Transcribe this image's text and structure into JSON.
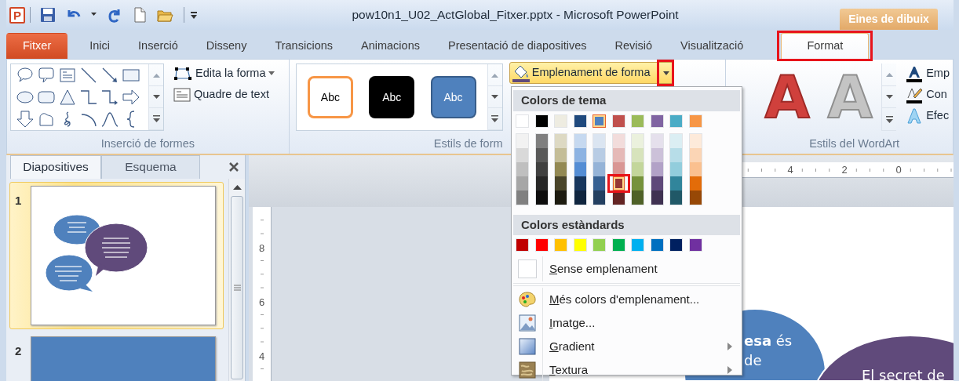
{
  "window": {
    "app_logo": "P",
    "title": "pow10n1_U02_ActGlobal_Fitxer.pptx - Microsoft PowerPoint",
    "context_tab": "Eines de dibuix"
  },
  "tabs": [
    {
      "label": "Fitxer",
      "kind": "file",
      "selected": false,
      "highlighted": false
    },
    {
      "label": "Inici",
      "kind": "normal",
      "selected": false,
      "highlighted": false
    },
    {
      "label": "Inserció",
      "kind": "normal",
      "selected": false,
      "highlighted": false
    },
    {
      "label": "Disseny",
      "kind": "normal",
      "selected": false,
      "highlighted": false
    },
    {
      "label": "Transicions",
      "kind": "normal",
      "selected": false,
      "highlighted": false
    },
    {
      "label": "Animacions",
      "kind": "normal",
      "selected": false,
      "highlighted": false
    },
    {
      "label": "Presentació de diapositives",
      "kind": "normal",
      "selected": false,
      "highlighted": false
    },
    {
      "label": "Revisió",
      "kind": "normal",
      "selected": false,
      "highlighted": false
    },
    {
      "label": "Visualització",
      "kind": "normal",
      "selected": false,
      "highlighted": false
    },
    {
      "label": "Format",
      "kind": "context",
      "selected": true,
      "highlighted": true
    }
  ],
  "ribbon": {
    "shapes_group": {
      "label": "Inserció de formes",
      "commands": [
        {
          "label": "Edita la forma",
          "kind": "edit",
          "dropdown": true
        },
        {
          "label": "Quadre de text",
          "kind": "textbox",
          "dropdown": false
        }
      ]
    },
    "styles_group": {
      "label": "Estils de form",
      "presets": [
        {
          "text": "Abc",
          "kind": "outline"
        },
        {
          "text": "Abc",
          "kind": "dark"
        },
        {
          "text": "Abc",
          "kind": "filled"
        }
      ],
      "fill_button": {
        "label": "Emplenament de forma",
        "open": true,
        "highlighted": true
      }
    },
    "wordart_group": {
      "label": "Estils del WordArt",
      "presets": [
        {
          "text": "A",
          "kind": "red"
        },
        {
          "text": "A",
          "kind": "white"
        }
      ],
      "commands": [
        {
          "label": "Emp",
          "kind": "text_fill"
        },
        {
          "label": "Con",
          "kind": "text_outline"
        },
        {
          "label": "Efec",
          "kind": "text_effects"
        }
      ]
    }
  },
  "slides_pane": {
    "tabs": [
      {
        "label": "Diapositives",
        "selected": true
      },
      {
        "label": "Esquema",
        "selected": false
      }
    ],
    "thumbnails": [
      {
        "number": "1",
        "selected": true,
        "kind": "bubbles"
      },
      {
        "number": "2",
        "selected": false,
        "kind": "blue"
      }
    ]
  },
  "rulers": {
    "horizontal": [
      "4",
      "2",
      "0"
    ],
    "vertical": [
      "8",
      "6",
      "4"
    ]
  },
  "slide": {
    "bubbles": [
      {
        "color": "#4f81bd",
        "lines": [
          "**esa** és",
          "de"
        ]
      },
      {
        "color": "#604a7b",
        "lines": [
          "El secret de"
        ]
      }
    ]
  },
  "fill_menu": {
    "theme_heading": "Colors de tema",
    "theme_colors": [
      {
        "color": "#ffffff",
        "selected": false,
        "shades": [
          {
            "color": "#f2f2f2",
            "selected": false,
            "highlighted": false
          },
          {
            "color": "#d9d9d9",
            "selected": false,
            "highlighted": false
          },
          {
            "color": "#bfbfbf",
            "selected": false,
            "highlighted": false
          },
          {
            "color": "#a6a6a6",
            "selected": false,
            "highlighted": false
          },
          {
            "color": "#808080",
            "selected": false,
            "highlighted": false
          }
        ]
      },
      {
        "color": "#000000",
        "selected": false,
        "shades": [
          {
            "color": "#7f7f7f",
            "selected": false,
            "highlighted": false
          },
          {
            "color": "#595959",
            "selected": false,
            "highlighted": false
          },
          {
            "color": "#404040",
            "selected": false,
            "highlighted": false
          },
          {
            "color": "#262626",
            "selected": false,
            "highlighted": false
          },
          {
            "color": "#0d0d0d",
            "selected": false,
            "highlighted": false
          }
        ]
      },
      {
        "color": "#eeece1",
        "selected": false,
        "shades": [
          {
            "color": "#ddd9c3",
            "selected": false,
            "highlighted": false
          },
          {
            "color": "#c4bd97",
            "selected": false,
            "highlighted": false
          },
          {
            "color": "#938953",
            "selected": false,
            "highlighted": false
          },
          {
            "color": "#494429",
            "selected": false,
            "highlighted": false
          },
          {
            "color": "#1d1b10",
            "selected": false,
            "highlighted": false
          }
        ]
      },
      {
        "color": "#1f497d",
        "selected": false,
        "shades": [
          {
            "color": "#c6d9f0",
            "selected": false,
            "highlighted": false
          },
          {
            "color": "#8db3e2",
            "selected": false,
            "highlighted": false
          },
          {
            "color": "#548dd4",
            "selected": false,
            "highlighted": false
          },
          {
            "color": "#17365d",
            "selected": false,
            "highlighted": false
          },
          {
            "color": "#0f243e",
            "selected": false,
            "highlighted": false
          }
        ]
      },
      {
        "color": "#4f81bd",
        "selected": true,
        "shades": [
          {
            "color": "#dbe5f1",
            "selected": false,
            "highlighted": false
          },
          {
            "color": "#b8cce4",
            "selected": false,
            "highlighted": false
          },
          {
            "color": "#95b3d7",
            "selected": false,
            "highlighted": false
          },
          {
            "color": "#366092",
            "selected": false,
            "highlighted": false
          },
          {
            "color": "#244061",
            "selected": false,
            "highlighted": false
          }
        ]
      },
      {
        "color": "#c0504d",
        "selected": false,
        "shades": [
          {
            "color": "#f2dcdb",
            "selected": false,
            "highlighted": false
          },
          {
            "color": "#e5b9b7",
            "selected": false,
            "highlighted": false
          },
          {
            "color": "#d99694",
            "selected": false,
            "highlighted": false
          },
          {
            "color": "#953734",
            "selected": true,
            "highlighted": true
          },
          {
            "color": "#632423",
            "selected": false,
            "highlighted": false
          }
        ]
      },
      {
        "color": "#9bbb59",
        "selected": false,
        "shades": [
          {
            "color": "#ebf1dd",
            "selected": false,
            "highlighted": false
          },
          {
            "color": "#d7e3bc",
            "selected": false,
            "highlighted": false
          },
          {
            "color": "#c3d69b",
            "selected": false,
            "highlighted": false
          },
          {
            "color": "#76923c",
            "selected": false,
            "highlighted": false
          },
          {
            "color": "#4f6128",
            "selected": false,
            "highlighted": false
          }
        ]
      },
      {
        "color": "#8064a2",
        "selected": false,
        "shades": [
          {
            "color": "#e5e0ec",
            "selected": false,
            "highlighted": false
          },
          {
            "color": "#ccc1d9",
            "selected": false,
            "highlighted": false
          },
          {
            "color": "#b2a2c7",
            "selected": false,
            "highlighted": false
          },
          {
            "color": "#5f497a",
            "selected": false,
            "highlighted": false
          },
          {
            "color": "#3f3151",
            "selected": false,
            "highlighted": false
          }
        ]
      },
      {
        "color": "#4bacc6",
        "selected": false,
        "shades": [
          {
            "color": "#dbeef3",
            "selected": false,
            "highlighted": false
          },
          {
            "color": "#b7dde8",
            "selected": false,
            "highlighted": false
          },
          {
            "color": "#92cddc",
            "selected": false,
            "highlighted": false
          },
          {
            "color": "#31859b",
            "selected": false,
            "highlighted": false
          },
          {
            "color": "#205867",
            "selected": false,
            "highlighted": false
          }
        ]
      },
      {
        "color": "#f79646",
        "selected": false,
        "shades": [
          {
            "color": "#fdeada",
            "selected": false,
            "highlighted": false
          },
          {
            "color": "#fbd5b5",
            "selected": false,
            "highlighted": false
          },
          {
            "color": "#fac08f",
            "selected": false,
            "highlighted": false
          },
          {
            "color": "#e36c09",
            "selected": false,
            "highlighted": false
          },
          {
            "color": "#974806",
            "selected": false,
            "highlighted": false
          }
        ]
      }
    ],
    "standard_heading": "Colors estàndards",
    "standard_colors": [
      {
        "color": "#c00000",
        "selected": false
      },
      {
        "color": "#ff0000",
        "selected": false
      },
      {
        "color": "#ffc000",
        "selected": false
      },
      {
        "color": "#ffff00",
        "selected": false
      },
      {
        "color": "#92d050",
        "selected": false
      },
      {
        "color": "#00b050",
        "selected": false
      },
      {
        "color": "#00b0f0",
        "selected": false
      },
      {
        "color": "#0070c0",
        "selected": false
      },
      {
        "color": "#002060",
        "selected": false
      },
      {
        "color": "#7030a0",
        "selected": false
      }
    ],
    "items": [
      {
        "label": "Sense emplenament",
        "kind": "no_fill",
        "submenu": false,
        "mnemonic": true
      },
      {
        "label": "Més colors d'emplenament...",
        "kind": "palette",
        "submenu": false,
        "mnemonic": true
      },
      {
        "label": "Imatge...",
        "kind": "picture",
        "submenu": false,
        "mnemonic": true
      },
      {
        "label": "Gradient",
        "kind": "gradient",
        "submenu": true,
        "mnemonic": true
      },
      {
        "label": "Textura",
        "kind": "texture",
        "submenu": true,
        "mnemonic": true
      }
    ]
  }
}
